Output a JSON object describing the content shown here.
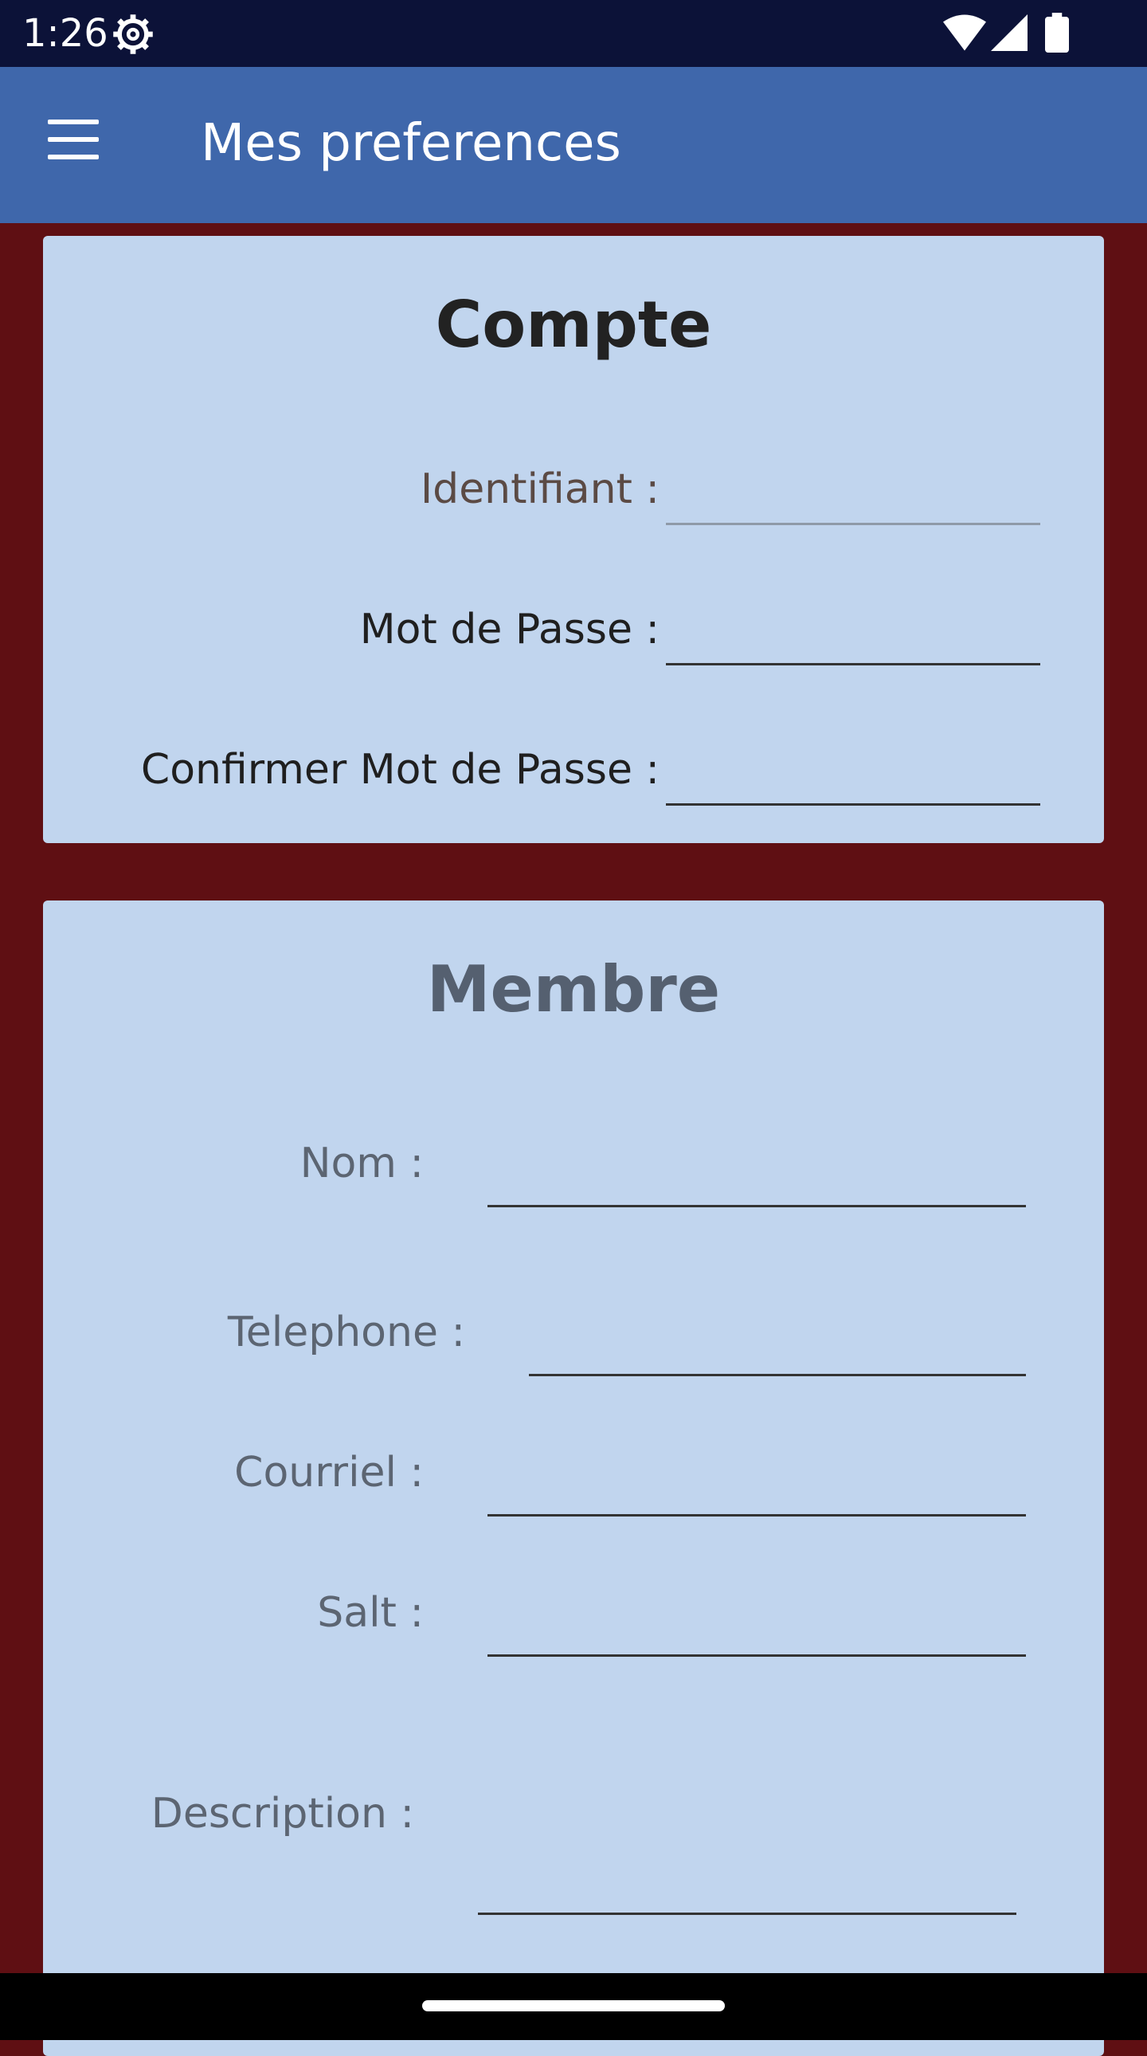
{
  "status_bar": {
    "time": "1:26",
    "icons": [
      "settings-gear-icon",
      "wifi-icon",
      "cell-signal-icon",
      "battery-icon"
    ]
  },
  "app_bar": {
    "title": "Mes preferences",
    "menu_icon": "hamburger-menu-icon",
    "color": "#3f67ab"
  },
  "compte": {
    "title": "Compte",
    "identifiant_label": "Identifiant :",
    "identifiant_value": "",
    "mot_de_passe_label": "Mot de Passe :",
    "mot_de_passe_value": "",
    "confirmer_label": "Confirmer Mot de Passe :",
    "confirmer_value": ""
  },
  "membre": {
    "title": "Membre",
    "nom_label": "Nom :",
    "nom_value": "",
    "telephone_label": "Telephone :",
    "telephone_value": "",
    "courriel_label": "Courriel :",
    "courriel_value": "",
    "salt_label": "Salt :",
    "salt_value": "",
    "description_label": "Description :",
    "description_value": ""
  },
  "colors": {
    "background": "#5f0f13",
    "card": "#c1d5ee",
    "status_bar": "#0c1238"
  }
}
